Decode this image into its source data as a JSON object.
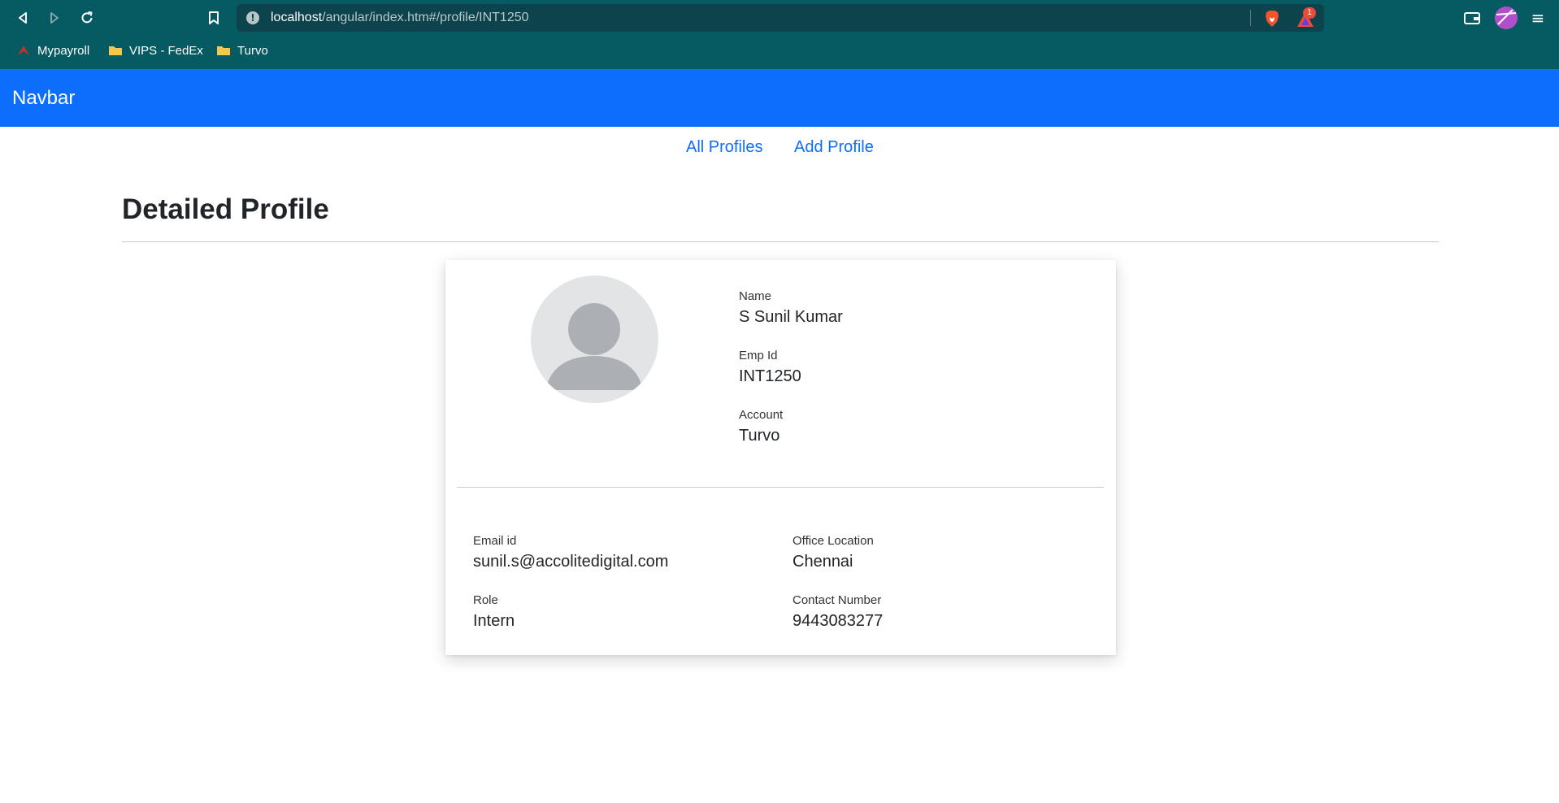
{
  "browser": {
    "url_host": "localhost",
    "url_path": "/angular/index.htm#/profile/INT1250",
    "rewards_badge": "1",
    "bookmarks": [
      {
        "label": "Mypayroll",
        "icon": "mypayroll-icon"
      },
      {
        "label": "VIPS - FedEx",
        "icon": "folder-icon"
      },
      {
        "label": "Turvo",
        "icon": "folder-icon"
      }
    ]
  },
  "navbar": {
    "brand": "Navbar",
    "color": "#0d6efd"
  },
  "links": {
    "all_profiles": "All Profiles",
    "add_profile": "Add Profile"
  },
  "page": {
    "title": "Detailed Profile"
  },
  "profile": {
    "name_label": "Name",
    "name": "S Sunil Kumar",
    "emp_id_label": "Emp Id",
    "emp_id": "INT1250",
    "account_label": "Account",
    "account": "Turvo",
    "email_label": "Email id",
    "email": "sunil.s@accolitedigital.com",
    "office_label": "Office Location",
    "office": "Chennai",
    "role_label": "Role",
    "role": "Intern",
    "contact_label": "Contact Number",
    "contact": "9443083277"
  },
  "colors": {
    "browser_chrome": "#065a61",
    "url_bar": "#0d434c",
    "link": "#0d6efd"
  }
}
